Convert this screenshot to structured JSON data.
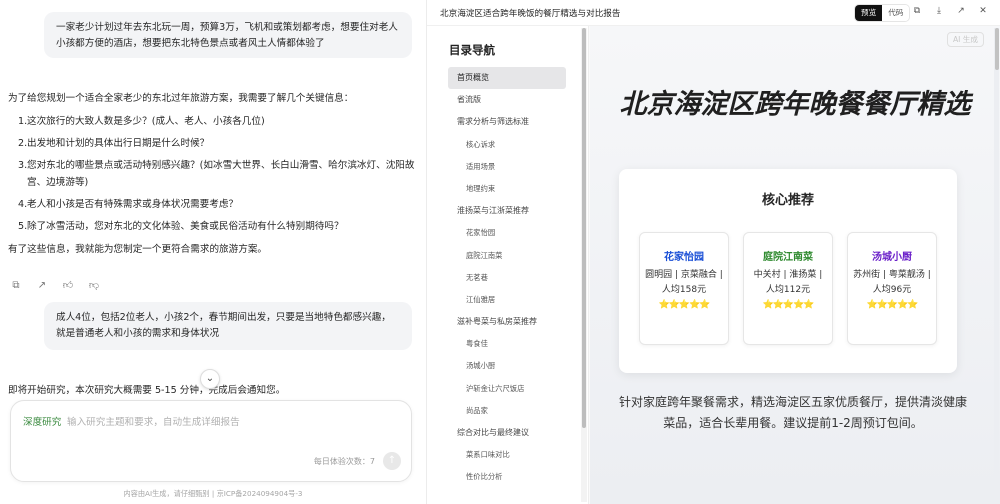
{
  "chat": {
    "user_msg_1": "一家老少计划过年去东北玩一周，预算3万，飞机和或策划都考虑，想要住对老人小孩都方便的酒店，想要把东北特色景点或者风土人情都体验了",
    "assistant_intro": "为了给您规划一个适合全家老少的东北过年旅游方案，我需要了解几个关键信息：",
    "questions": [
      {
        "num": "1.",
        "text": "这次旅行的大致人数是多少？(成人、老人、小孩各几位)"
      },
      {
        "num": "2.",
        "text": "出发地和计划的具体出行日期是什么时候？"
      },
      {
        "num": "3.",
        "text": "您对东北的哪些景点或活动特别感兴趣？(如冰雪大世界、长白山滑雪、哈尔滨冰灯、沈阳故宫、边境游等)"
      },
      {
        "num": "4.",
        "text": "老人和小孩是否有特殊需求或身体状况需要考虑？"
      },
      {
        "num": "5.",
        "text": "除了冰雪活动，您对东北的文化体验、美食或民俗活动有什么特别期待吗？"
      }
    ],
    "assistant_outro": "有了这些信息，我就能为您制定一个更符合需求的旅游方案。",
    "user_msg_2": "成人4位，包括2位老人，小孩2个，春节期间出发，只要是当地特色都感兴趣，就是普通老人和小孩的需求和身体状况",
    "research_note": "即将开始研究，本次研究大概需要 5-15 分钟，完成后会通知您。",
    "input": {
      "mode_label": "深度研究",
      "placeholder": "输入研究主题和要求，自动生成详细报告",
      "quota": "每日体验次数：7"
    },
    "footer": "内容由AI生成，请仔细甄别  |  京ICP备2024094904号-3"
  },
  "preview": {
    "title": "北京海淀区适合跨年晚饭的餐厅精选与对比报告",
    "toggle": {
      "preview": "预览",
      "code": "代码"
    },
    "ai_badge": "AI 生成",
    "nav": {
      "title": "目录导航",
      "items": [
        {
          "label": "首页概览",
          "level": 1,
          "active": true
        },
        {
          "label": "省流版",
          "level": 1
        },
        {
          "label": "需求分析与筛选标准",
          "level": 1
        },
        {
          "label": "核心诉求",
          "level": 2
        },
        {
          "label": "适用场景",
          "level": 2
        },
        {
          "label": "地理约束",
          "level": 2
        },
        {
          "label": "淮扬菜与江浙菜推荐",
          "level": 1
        },
        {
          "label": "花家怡园",
          "level": 2
        },
        {
          "label": "庭院江南菜",
          "level": 2
        },
        {
          "label": "无茗巷",
          "level": 2
        },
        {
          "label": "江仙雅居",
          "level": 2
        },
        {
          "label": "滋补粤菜与私房菜推荐",
          "level": 1
        },
        {
          "label": "粤食佳",
          "level": 2
        },
        {
          "label": "汤城小厨",
          "level": 2
        },
        {
          "label": "沪斩金让六尺饭店",
          "level": 2
        },
        {
          "label": "尚品家",
          "level": 2
        },
        {
          "label": "综合对比与最终建议",
          "level": 1
        },
        {
          "label": "菜系口味对比",
          "level": 2
        },
        {
          "label": "性价比分析",
          "level": 2
        }
      ]
    },
    "hero_title": "北京海淀区跨年晚餐餐厅精选",
    "card": {
      "title": "核心推荐",
      "restaurants": [
        {
          "name": "花家怡园",
          "desc": "圆明园 | 京菜融合 | 人均158元",
          "stars": "⭐⭐⭐⭐⭐",
          "color": "#1a4fd6"
        },
        {
          "name": "庭院江南菜",
          "desc": "中关村 | 淮扬菜 | 人均112元",
          "stars": "⭐⭐⭐⭐⭐",
          "color": "#2f8a2f"
        },
        {
          "name": "汤城小厨",
          "desc": "苏州街 | 粤菜靓汤 | 人均96元",
          "stars": "⭐⭐⭐⭐⭐",
          "color": "#6a1fc9"
        }
      ]
    },
    "summary": "针对家庭跨年聚餐需求，精选海淀区五家优质餐厅，提供清淡健康菜品，适合长辈用餐。建议提前1-2周预订包间。"
  }
}
